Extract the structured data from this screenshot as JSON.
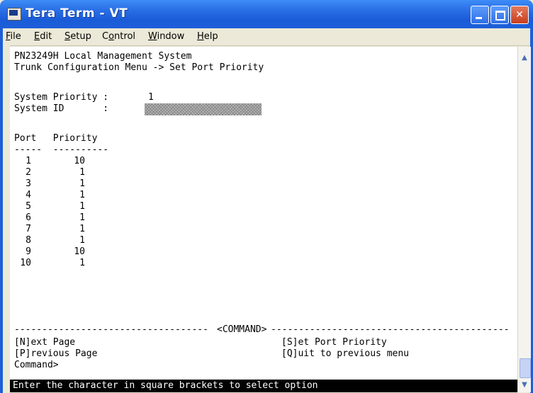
{
  "window": {
    "title": "Tera Term - VT",
    "icon": "teraterm-app-icon"
  },
  "titlebar_buttons": {
    "minimize_icon": "minimize-icon",
    "maximize_icon": "maximize-icon",
    "close_icon": "close-icon",
    "close_glyph": "✕"
  },
  "menu": {
    "file": {
      "first": "F",
      "rest": "ile"
    },
    "edit": {
      "first": "E",
      "rest": "dit"
    },
    "setup": {
      "first": "S",
      "rest": "etup"
    },
    "control": {
      "pre": "C",
      "u": "o",
      "rest": "ntrol"
    },
    "window": {
      "first": "W",
      "rest": "indow"
    },
    "help": {
      "first": "H",
      "rest": "elp"
    }
  },
  "terminal": {
    "header1": "PN23249H Local Management System",
    "header2": "Trunk Configuration Menu -> Set Port Priority",
    "system_priority_label": "System Priority :",
    "system_priority_value": "1",
    "system_id_label": "System ID       :",
    "table_header": "Port   Priority",
    "table_rule": "-----  ----------",
    "rows": [
      {
        "port": "1",
        "priority": "10"
      },
      {
        "port": "2",
        "priority": "1"
      },
      {
        "port": "3",
        "priority": "1"
      },
      {
        "port": "4",
        "priority": "1"
      },
      {
        "port": "5",
        "priority": "1"
      },
      {
        "port": "6",
        "priority": "1"
      },
      {
        "port": "7",
        "priority": "1"
      },
      {
        "port": "8",
        "priority": "1"
      },
      {
        "port": "9",
        "priority": "10"
      },
      {
        "port": "10",
        "priority": "1"
      }
    ],
    "command_rule_left": "-----------------------------------",
    "command_label": "<COMMAND>",
    "command_rule_right": "-------------------------------------------",
    "cmd_next": "[N]ext Page",
    "cmd_set": "[S]et Port Priority",
    "cmd_prev": "[P]revious Page",
    "cmd_quit": "[Q]uit to previous menu",
    "prompt": "Command>",
    "status": "Enter the character in square brackets to select option"
  },
  "scrollbar": {
    "up_glyph": "▲",
    "down_glyph": "▼"
  }
}
